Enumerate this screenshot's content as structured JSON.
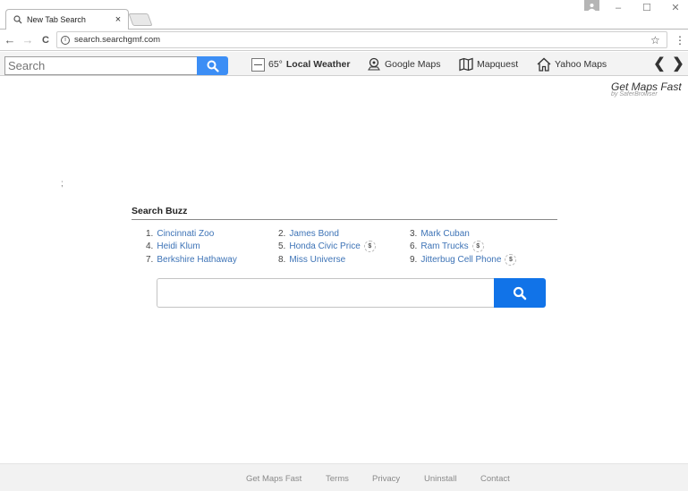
{
  "browser": {
    "tab": {
      "title": "New Tab Search",
      "close": "×"
    },
    "url": "search.searchgmf.com",
    "nav": {
      "back": "←",
      "forward": "→",
      "reload": "C"
    },
    "window_buttons": {
      "minimize": "–",
      "maximize": "☐",
      "close": "✕"
    },
    "star": "☆",
    "menu": "⋮",
    "info": "i"
  },
  "extension_toolbar": {
    "search_placeholder": "Search",
    "weather": {
      "temp": "65°",
      "label": "Local Weather"
    },
    "links": [
      {
        "label": "Google Maps",
        "icon": "map-pin-icon"
      },
      {
        "label": "Mapquest",
        "icon": "folded-map-icon"
      },
      {
        "label": "Yahoo Maps",
        "icon": "house-icon"
      }
    ],
    "arrows": {
      "prev": "❮",
      "next": "❯"
    }
  },
  "brand": {
    "title": "Get Maps Fast",
    "subtitle": "by SaferBrowser"
  },
  "stray_mark": ";",
  "buzz": {
    "title": "Search Buzz",
    "items": [
      {
        "num": "1.",
        "label": "Cincinnati Zoo",
        "paid": false
      },
      {
        "num": "2.",
        "label": "James Bond",
        "paid": false
      },
      {
        "num": "3.",
        "label": "Mark Cuban",
        "paid": false
      },
      {
        "num": "4.",
        "label": "Heidi Klum",
        "paid": false
      },
      {
        "num": "5.",
        "label": "Honda Civic Price",
        "paid": true
      },
      {
        "num": "6.",
        "label": "Ram Trucks",
        "paid": true
      },
      {
        "num": "7.",
        "label": "Berkshire Hathaway",
        "paid": false
      },
      {
        "num": "8.",
        "label": "Miss Universe",
        "paid": false
      },
      {
        "num": "9.",
        "label": "Jitterbug Cell Phone",
        "paid": true
      }
    ],
    "paid_badge": "$"
  },
  "main_search": {
    "value": "",
    "placeholder": ""
  },
  "footer": {
    "links": [
      "Get Maps Fast",
      "Terms",
      "Privacy",
      "Uninstall",
      "Contact"
    ]
  },
  "colors": {
    "accent_blue": "#1173e8",
    "toolbar_blue": "#3c8ef5",
    "link_blue": "#3d73b6"
  }
}
